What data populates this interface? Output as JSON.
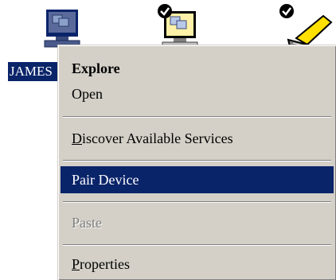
{
  "desktop": {
    "selected_icon_label": "JAMES",
    "icons": [
      {
        "name": "computer-icon"
      },
      {
        "name": "computer-checked-icon"
      },
      {
        "name": "laptop-checked-icon"
      }
    ]
  },
  "context_menu": {
    "explore": "Explore",
    "open": "Open",
    "discover_mnemonic": "D",
    "discover_rest": "iscover Available Services",
    "pair_device": "Pair Device",
    "paste": "Paste",
    "properties_mnemonic": "P",
    "properties_rest": "roperties"
  },
  "colors": {
    "selection": "#0a246a",
    "menu_face": "#d4d0c8",
    "disabled_text": "#808080"
  }
}
